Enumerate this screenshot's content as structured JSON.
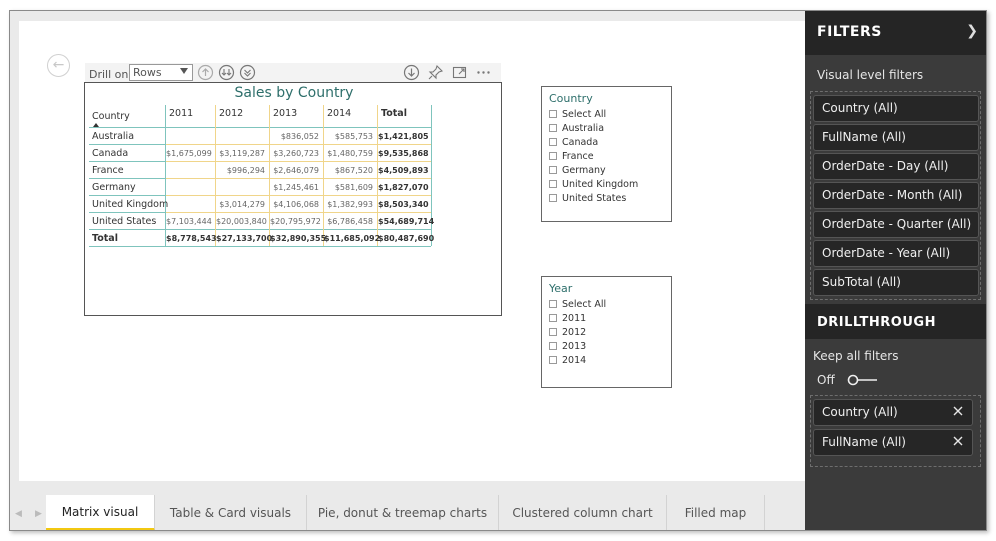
{
  "visual_header": {
    "drill_label": "Drill on",
    "drill_value": "Rows"
  },
  "matrix": {
    "title": "Sales by Country",
    "columns": [
      "Country",
      "2011",
      "2012",
      "2013",
      "2014",
      "Total"
    ],
    "rows": [
      {
        "country": "Australia",
        "v2011": "",
        "v2012": "",
        "v2013": "$836,052",
        "v2014": "$585,753",
        "total": "$1,421,805"
      },
      {
        "country": "Canada",
        "v2011": "$1,675,099",
        "v2012": "$3,119,287",
        "v2013": "$3,260,723",
        "v2014": "$1,480,759",
        "total": "$9,535,868"
      },
      {
        "country": "France",
        "v2011": "",
        "v2012": "$996,294",
        "v2013": "$2,646,079",
        "v2014": "$867,520",
        "total": "$4,509,893"
      },
      {
        "country": "Germany",
        "v2011": "",
        "v2012": "",
        "v2013": "$1,245,461",
        "v2014": "$581,609",
        "total": "$1,827,070"
      },
      {
        "country": "United Kingdom",
        "v2011": "",
        "v2012": "$3,014,279",
        "v2013": "$4,106,068",
        "v2014": "$1,382,993",
        "total": "$8,503,340"
      },
      {
        "country": "United States",
        "v2011": "$7,103,444",
        "v2012": "$20,003,840",
        "v2013": "$20,795,972",
        "v2014": "$6,786,458",
        "total": "$54,689,714"
      }
    ],
    "total_row": {
      "label": "Total",
      "v2011": "$8,778,543",
      "v2012": "$27,133,700",
      "v2013": "$32,890,355",
      "v2014": "$11,685,092",
      "total": "$80,487,690"
    }
  },
  "country_slicer": {
    "title": "Country",
    "items": [
      "Select All",
      "Australia",
      "Canada",
      "France",
      "Germany",
      "United Kingdom",
      "United States"
    ]
  },
  "year_slicer": {
    "title": "Year",
    "items": [
      "Select All",
      "2011",
      "2012",
      "2013",
      "2014"
    ]
  },
  "tabs": [
    {
      "label": "Matrix visual",
      "active": true
    },
    {
      "label": "Table & Card visuals",
      "active": false
    },
    {
      "label": "Pie, donut & treemap charts",
      "active": false
    },
    {
      "label": "Clustered column chart",
      "active": false
    },
    {
      "label": "Filled map",
      "active": false
    }
  ],
  "filters_pane": {
    "title": "FILTERS",
    "visual_level_label": "Visual level filters",
    "visual_filters": [
      "Country (All)",
      "FullName (All)",
      "OrderDate - Day (All)",
      "OrderDate - Month (All)",
      "OrderDate - Quarter (All)",
      "OrderDate - Year (All)",
      "SubTotal (All)"
    ],
    "drillthrough_title": "DRILLTHROUGH",
    "keep_all_label": "Keep all filters",
    "toggle_label": "Off",
    "drillthrough_filters": [
      "Country (All)",
      "FullName (All)"
    ]
  },
  "colors": {
    "accent_teal": "#2e6f6b",
    "tab_underline": "#f2c811",
    "pane_bg": "#3b3b3b"
  }
}
